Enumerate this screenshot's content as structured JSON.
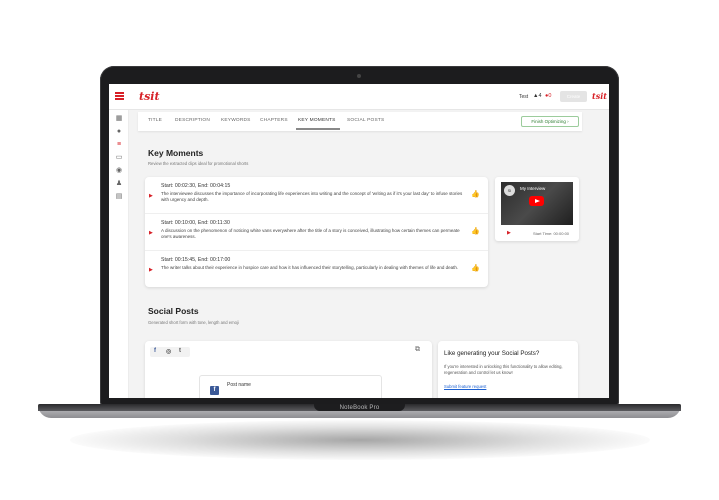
{
  "device": {
    "model_label": "NoteBook Pro"
  },
  "header": {
    "logo_text": "tsit",
    "user_label": "Test",
    "count_a": "▲4",
    "count_b": "●0",
    "create_label": "Create",
    "avatar_text": "tsit"
  },
  "sidebar": {
    "icons": [
      "dashboard-icon",
      "lightbulb-icon",
      "list-icon",
      "chat-icon",
      "play-icon",
      "person-icon",
      "card-icon"
    ]
  },
  "tabs": {
    "items": [
      "TITLE",
      "DESCRIPTION",
      "KEYWORDS",
      "CHAPTERS",
      "KEY MOMENTS",
      "SOCIAL POSTS"
    ],
    "active": "KEY MOMENTS",
    "finish_label": "Finish Optimizing  ›"
  },
  "key_moments": {
    "title": "Key Moments",
    "subtitle": "Review the extracted clips ideal for promotional shorts",
    "items": [
      {
        "time": "Start: 00:02:30, End: 00:04:15",
        "text": "The interviewee discusses the importance of incorporating life experiences into writing and the concept of 'writing as if it's your last day' to infuse stories with urgency and depth."
      },
      {
        "time": "Start: 00:10:00, End: 00:11:30",
        "text": "A discussion on the phenomenon of noticing white vans everywhere after the title of a story is conceived, illustrating how certain themes can permeate one's awareness."
      },
      {
        "time": "Start: 00:15:45, End: 00:17:00",
        "text": "The writer talks about their experience in hospice care and how it has influenced their storytelling, particularly in dealing with themes of life and death."
      }
    ]
  },
  "video": {
    "title": "My Interview",
    "start_label": "Start Time: 00:00:00"
  },
  "social_posts": {
    "title": "Social Posts",
    "subtitle": "Generated short form with tone, length and emoji",
    "post_name": "Post name",
    "platforms": [
      "f",
      "◎",
      "t"
    ]
  },
  "promo": {
    "title": "Like generating your Social Posts?",
    "text": "If you're interested in unlocking this functionality to allow editing, regeneration and control let us know!",
    "link": "Submit feature request"
  },
  "colors": {
    "accent": "#d71f26",
    "success": "#2e7d32"
  }
}
